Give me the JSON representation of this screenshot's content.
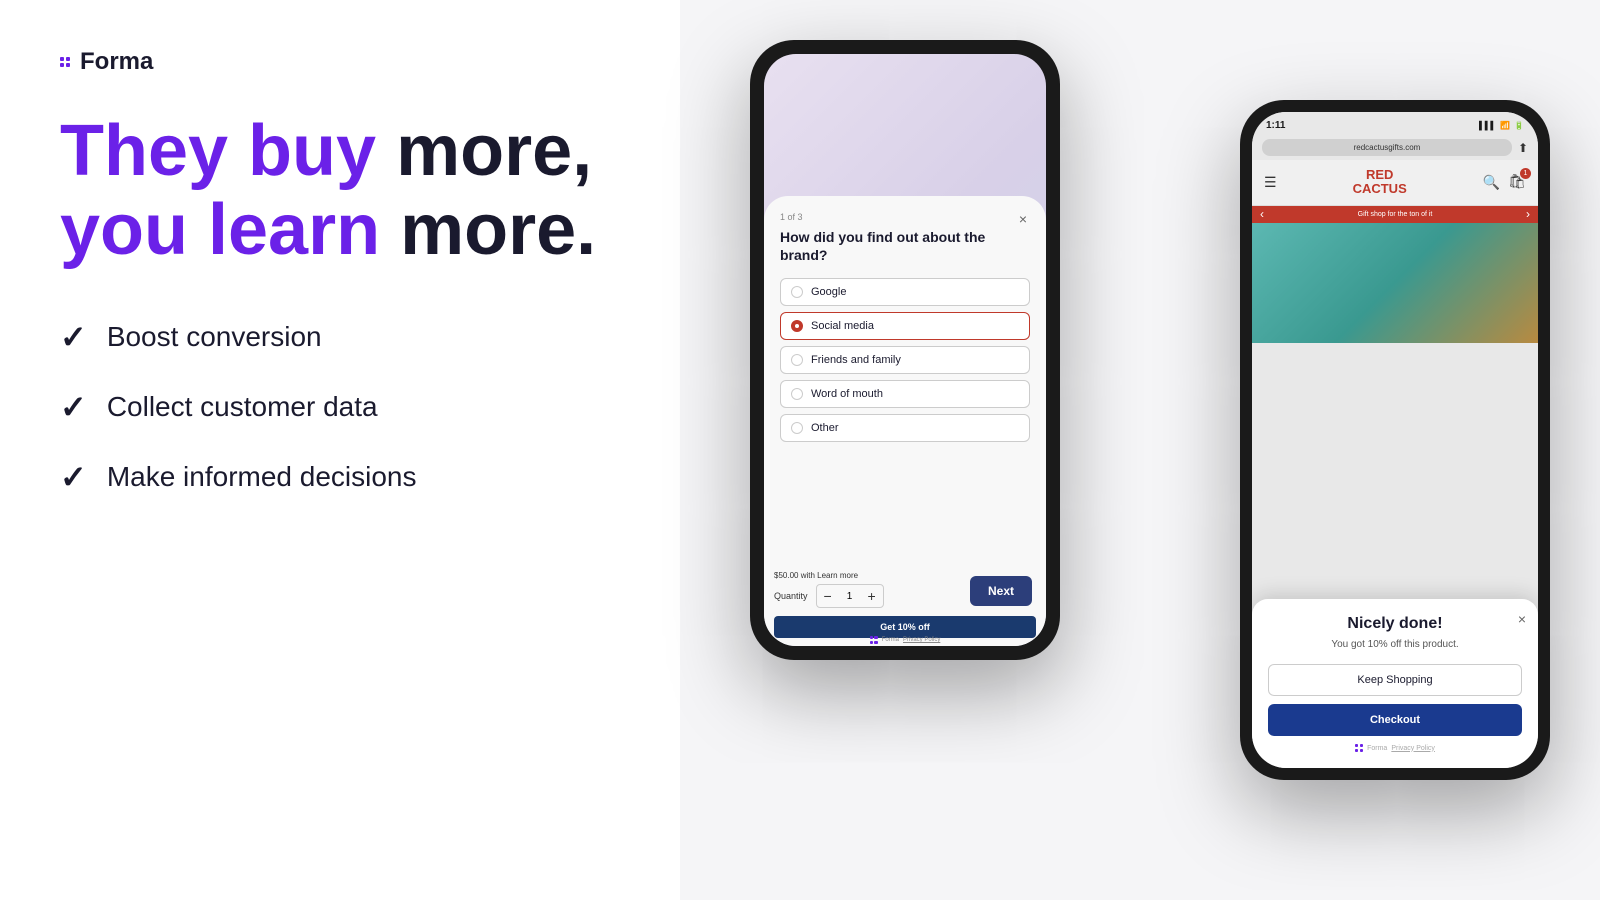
{
  "logo": {
    "text": "Forma"
  },
  "headline": {
    "line1_purple": "They buy",
    "line1_dark": " more,",
    "line2_purple": "you learn",
    "line2_dark": " more."
  },
  "features": [
    {
      "icon": "✓",
      "text": "Boost conversion"
    },
    {
      "icon": "✓",
      "text": "Collect customer data"
    },
    {
      "icon": "✓",
      "text": "Make informed decisions"
    }
  ],
  "survey_phone": {
    "step": "1 of 3",
    "question": "How did you find out about the brand?",
    "close_icon": "×",
    "options": [
      {
        "label": "Google",
        "selected": false
      },
      {
        "label": "Social media",
        "selected": true
      },
      {
        "label": "Friends and family",
        "selected": false
      },
      {
        "label": "Word of mouth",
        "selected": false
      },
      {
        "label": "Other",
        "selected": false
      }
    ],
    "next_button": "Next",
    "price_text": "$50.00 with  Learn more",
    "quantity_label": "Quantity",
    "qty_minus": "−",
    "qty_value": "1",
    "qty_plus": "+",
    "add_to_cart": "Get 10% off",
    "footer_text": "Forma  Privacy Policy"
  },
  "success_phone": {
    "status_time": "1:11",
    "url": "redcactusgifts.com",
    "store_name": "RED\nCACTUS",
    "promo_text": "Gift shop for the ton of it",
    "success_title": "Nicely done!",
    "success_desc": "You got 10% off this product.",
    "keep_shopping": "Keep Shopping",
    "checkout": "Checkout",
    "footer_text": "Forma  Privacy Policy"
  },
  "colors": {
    "purple": "#6b21e8",
    "dark": "#1a1a2e",
    "red": "#c0392b",
    "navy": "#1a3a8f",
    "teal": "#5cb8b2"
  }
}
